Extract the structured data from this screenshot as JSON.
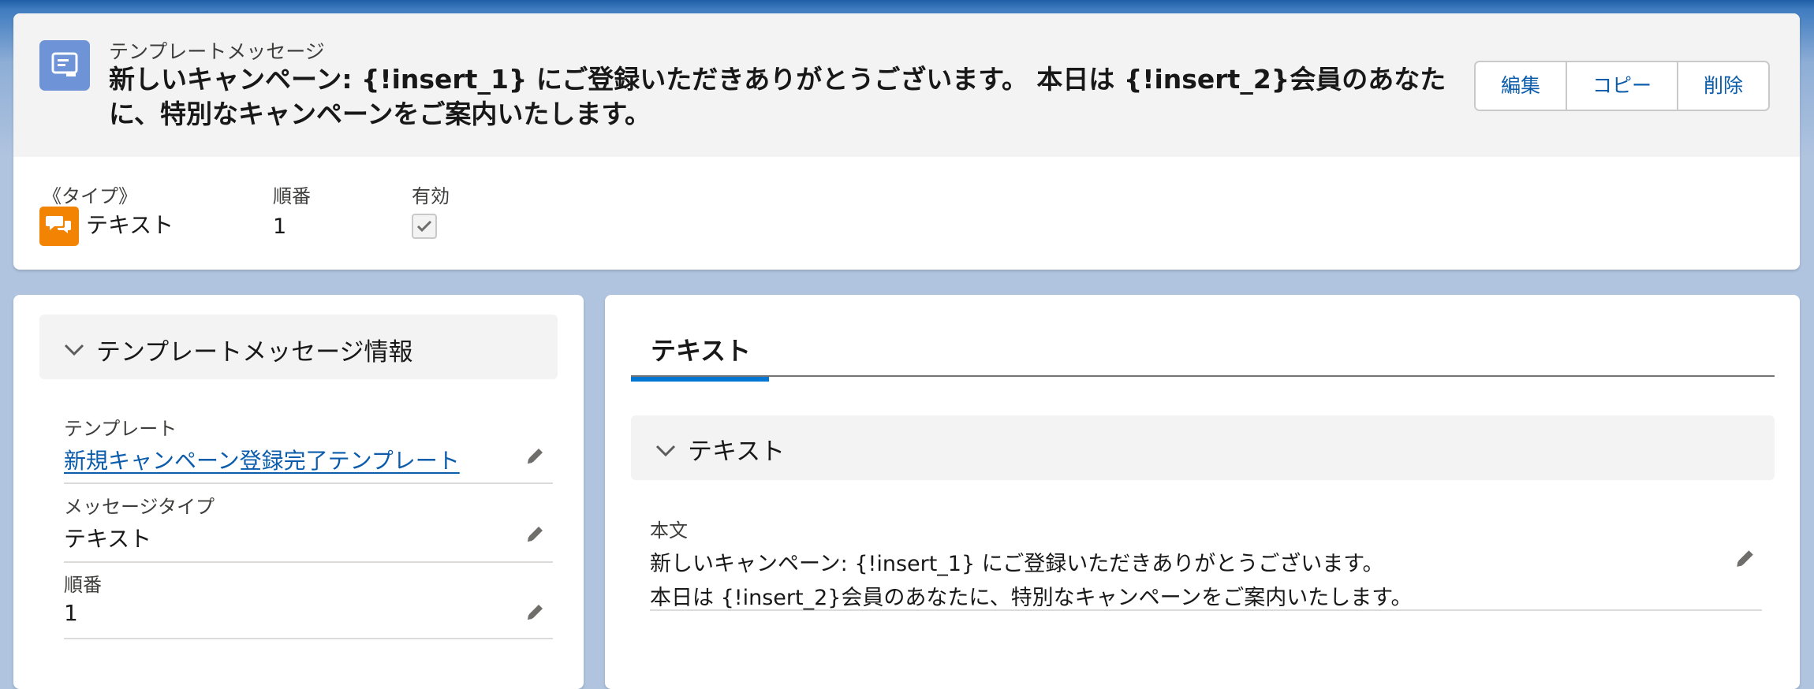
{
  "header": {
    "object_label": "テンプレートメッセージ",
    "title": "新しいキャンペーン: {!insert_1} にご登録いただきありがとうございます。 本日は {!insert_2}会員のあなたに、特別なキャンペーンをご案内いたします。",
    "buttons": {
      "edit": "編集",
      "copy": "コピー",
      "delete": "削除"
    },
    "icon": "template-record-icon"
  },
  "highlights": {
    "type": {
      "label": "《タイプ》",
      "value": "テキスト",
      "icon": "chat-bubbles-icon"
    },
    "order": {
      "label": "順番",
      "value": "1"
    },
    "active": {
      "label": "有効",
      "checked": true
    }
  },
  "details": {
    "section_title": "テンプレートメッセージ情報",
    "fields": [
      {
        "label": "テンプレート",
        "value": "新規キャンペーン登録完了テンプレート"
      },
      {
        "label": "メッセージタイプ",
        "value": "テキスト"
      },
      {
        "label": "順番",
        "value": "1"
      }
    ]
  },
  "text_panel": {
    "tab_label": "テキスト",
    "section_title": "テキスト",
    "body_label": "本文",
    "body_line1": "新しいキャンペーン: {!insert_1} にご登録いただきありがとうございます。",
    "body_line2": "本日は {!insert_2}会員のあなたに、特別なキャンペーンをご案内いたします。"
  },
  "colors": {
    "brand_link": "#0b5cab",
    "tab_active": "#0176d3",
    "record_icon_bg": "#6e93d6",
    "type_icon_bg": "#f38303"
  }
}
